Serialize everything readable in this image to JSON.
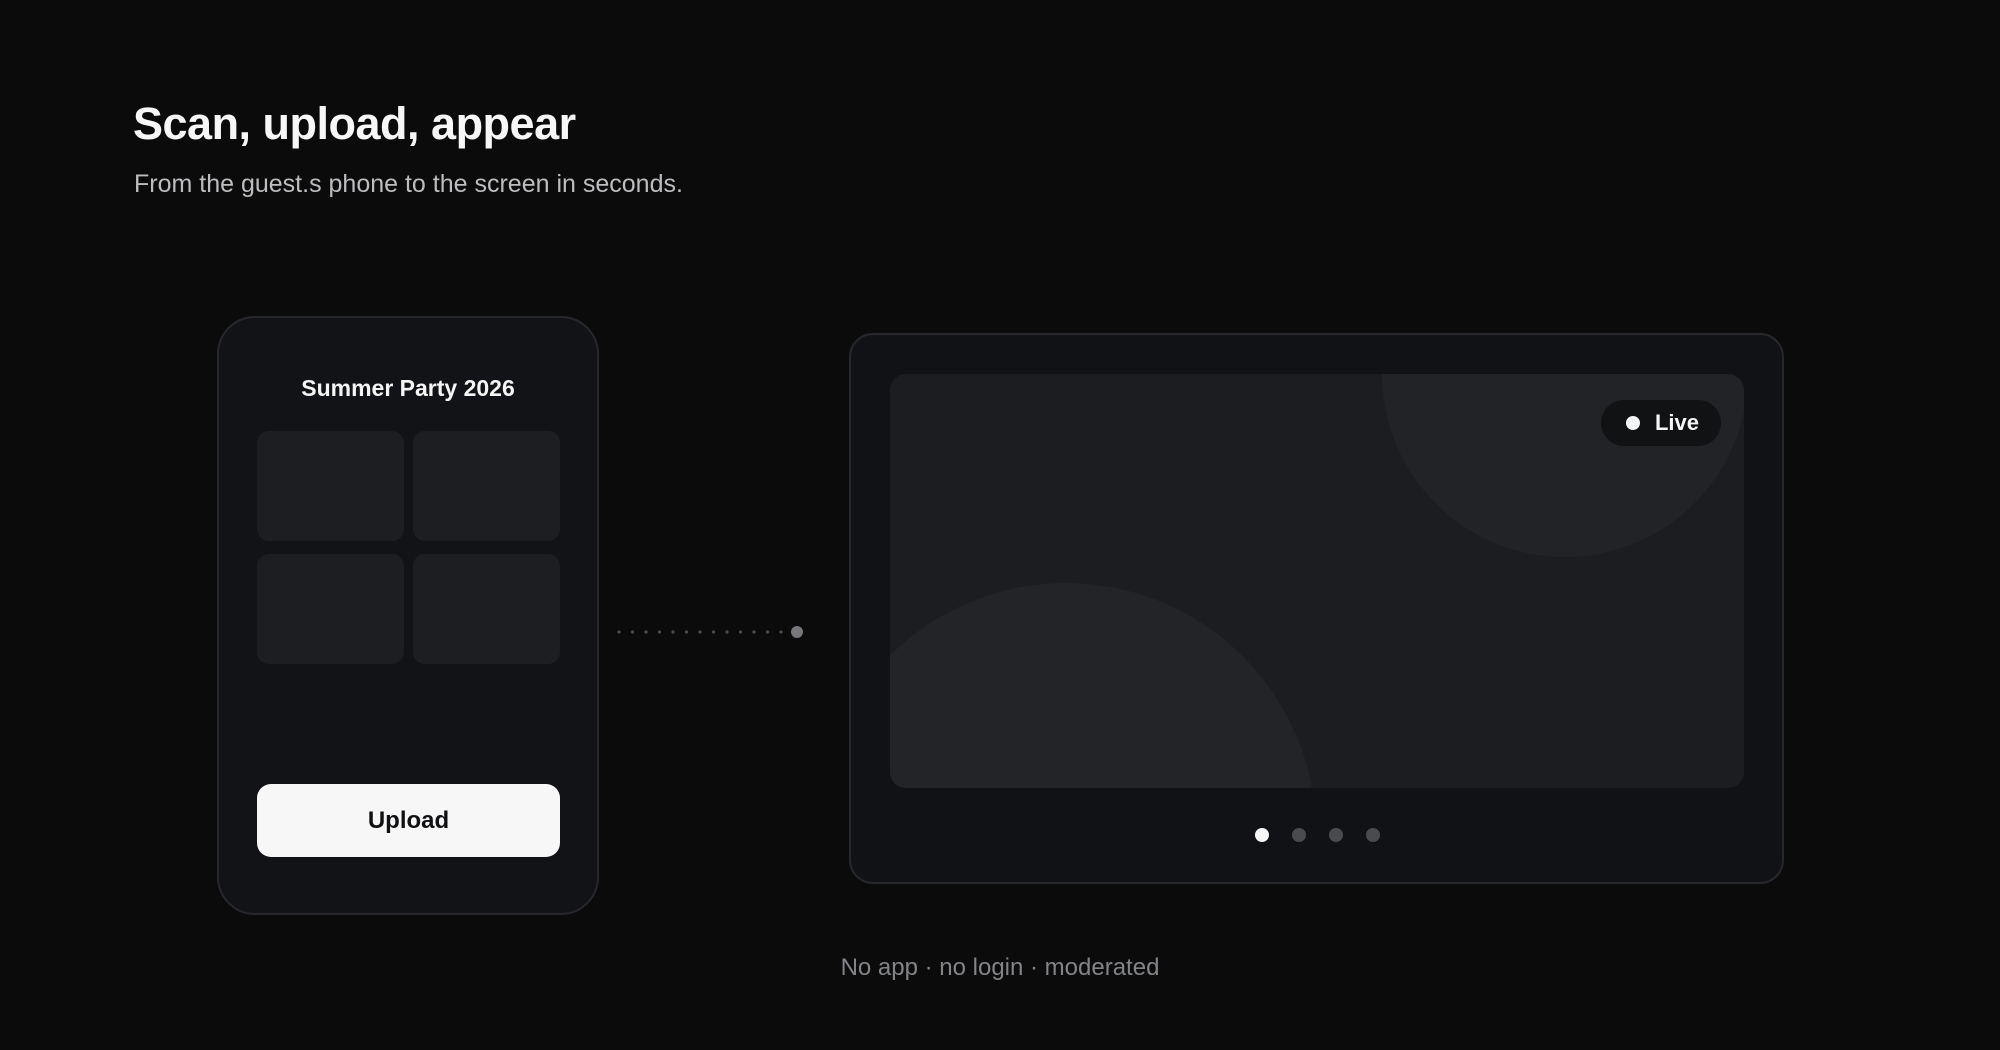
{
  "header": {
    "title": "Scan, upload, appear",
    "subtitle": "From the guest.s phone to the screen in seconds."
  },
  "phone": {
    "event_title": "Summer Party 2026",
    "thumbnail_count": 4,
    "upload_label": "Upload"
  },
  "screen": {
    "live_label": "Live",
    "slide_count": 4,
    "active_slide": 1
  },
  "footer": {
    "note": "No app · no login · moderated"
  },
  "colors": {
    "background": "#0b0b0c",
    "card": "#121316",
    "tile": "#1d1e21",
    "button": "#f7f7f7",
    "muted_text": "#838488"
  }
}
